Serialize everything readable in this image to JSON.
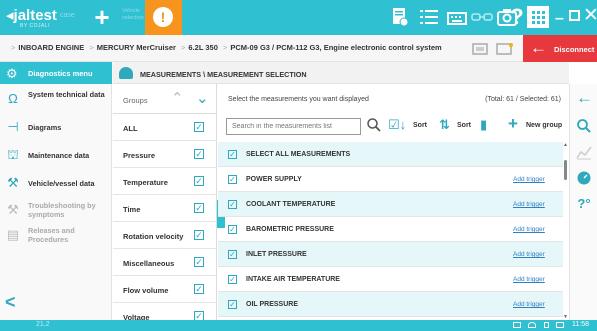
{
  "app": {
    "logo": "◂jaltest",
    "logo_sub": "BY COJALI",
    "mode_label": "case",
    "faint_label": "Vehicle selection",
    "alert_symbol": "!",
    "help_symbol": "?",
    "minimize_symbol": "–",
    "close_symbol": "✕"
  },
  "breadcrumb": [
    "INBOARD ENGINE",
    "MERCURY MerCruiser",
    "6.2L 350",
    "PCM-09 G3 / PCM-112 G3, Engine electronic control system"
  ],
  "disconnect": {
    "label": "Disconnect",
    "arrow": "←"
  },
  "sidebar": {
    "header": {
      "label": "Diagnostics menu",
      "icon": "diagnostics-icon"
    },
    "items": [
      {
        "label": "System technical data",
        "icon": "omega-icon",
        "disabled": false
      },
      {
        "label": "Diagrams",
        "icon": "diagram-icon",
        "disabled": false
      },
      {
        "label": "Maintenance data",
        "icon": "oil-can-icon",
        "disabled": false
      },
      {
        "label": "Vehicle/vessel data",
        "icon": "wrench-icon",
        "disabled": false
      },
      {
        "label": "Troubleshooting by symptoms",
        "icon": "tools-icon",
        "disabled": true
      },
      {
        "label": "Releases and Procedures",
        "icon": "document-icon",
        "disabled": true
      }
    ],
    "back_symbol": "<"
  },
  "main": {
    "title": "MEASUREMENTS \\ MEASUREMENT SELECTION",
    "groups_label": "Groups",
    "groups": [
      "ALL",
      "Pressure",
      "Temperature",
      "Time",
      "Rotation velocity",
      "Miscellaneous",
      "Flow volume",
      "Voltage"
    ],
    "info": "Select the measurements you want displayed",
    "total": "(Total: 61 / Selected: 61)",
    "search_placeholder": "Search in the measurements list",
    "sort1_label": "Sort",
    "sort2_label": "Sort",
    "new_group_label": "New group",
    "select_all_label": "SELECT ALL MEASUREMENTS",
    "trigger_label": "Add trigger",
    "measurements": [
      "POWER SUPPLY",
      "COOLANT TEMPERATURE",
      "BAROMETRIC PRESSURE",
      "INLET PRESSURE",
      "INTAKE AIR TEMPERATURE",
      "OIL PRESSURE"
    ]
  },
  "status": {
    "version": "21.2",
    "time": "11:58"
  },
  "colors": {
    "primary": "#2fc0d1",
    "accent": "#2fa7bd",
    "alert": "#f7941d",
    "disconnect": "#e6383d",
    "row_selected": "#e6f7f9"
  }
}
